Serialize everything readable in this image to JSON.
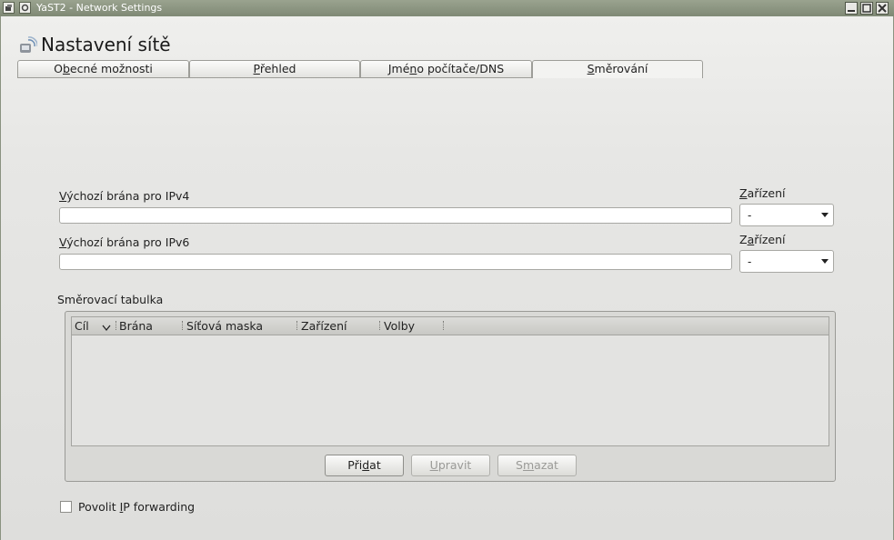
{
  "window": {
    "title": "YaST2 - Network Settings"
  },
  "header": {
    "title": "Nastavení sítě"
  },
  "tabs": [
    {
      "label": "Obecné možnosti"
    },
    {
      "label": "Přehled"
    },
    {
      "label": "Jméno počítače/DNS"
    },
    {
      "label": "Směrování"
    }
  ],
  "active_tab": "Směrování",
  "ipv4": {
    "label": "Výchozí brána pro IPv4",
    "value": "",
    "device_label": "Zařízení",
    "device_value": "-"
  },
  "ipv6": {
    "label": "Výchozí brána pro IPv6",
    "value": "",
    "device_label": "Zařízení",
    "device_value": "-"
  },
  "routing": {
    "title": "Směrovací tabulka",
    "columns": [
      "Cíl",
      "Brána",
      "Síťová maska",
      "Zařízení",
      "Volby"
    ],
    "rows": [],
    "buttons": {
      "add": "Přidat",
      "edit": "Upravit",
      "delete": "Smazat"
    }
  },
  "ip_forwarding": {
    "label": "Povolit IP forwarding",
    "checked": false
  },
  "icons": [
    "window-menu-icon",
    "pin-icon",
    "minimize-icon",
    "maximize-icon",
    "close-icon",
    "network-icon",
    "sort-descending-icon",
    "dropdown-arrow-icon"
  ]
}
